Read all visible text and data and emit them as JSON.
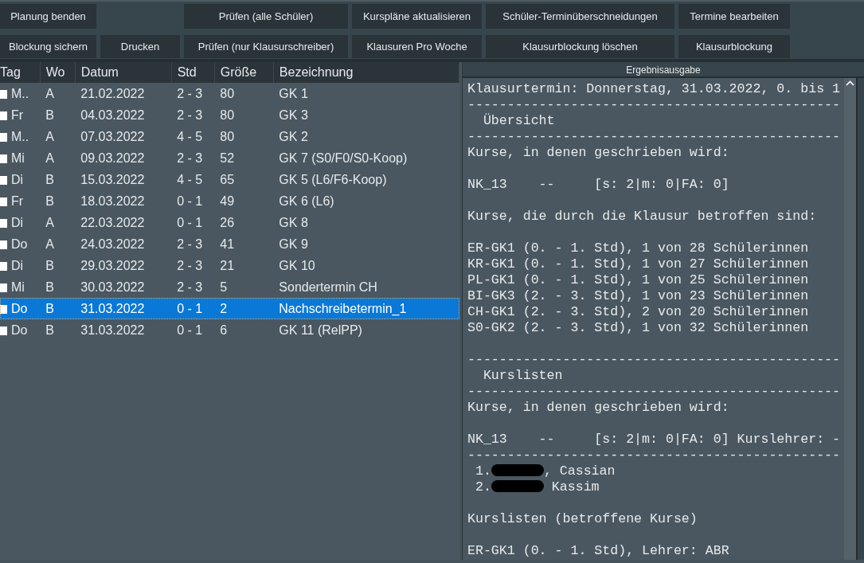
{
  "toolbar": {
    "rows": [
      [
        {
          "label": "Planung benden"
        },
        {
          "kind": "gap"
        },
        {
          "label": "Prüfen (alle Schüler)"
        },
        {
          "label": "Kurspläne aktualisieren"
        },
        {
          "label": "Schüler-Terminüberschneidungen"
        },
        {
          "label": "Termine bearbeiten"
        }
      ],
      [
        {
          "label": "Blockung sichern"
        },
        {
          "label": "Drucken"
        },
        {
          "label": "Prüfen (nur Klausurschreiber)"
        },
        {
          "label": "Klausuren Pro Woche"
        },
        {
          "label": "Klausurblockung löschen"
        },
        {
          "label": "Klausurblockung"
        }
      ]
    ]
  },
  "table": {
    "columns": [
      "Tag",
      "Wo",
      "Datum",
      "Std",
      "Größe",
      "Bezeichnung"
    ],
    "rows": [
      {
        "checked": false,
        "selected": false,
        "cells": [
          "M..",
          "A",
          "21.02.2022",
          "2 - 3",
          "80",
          "GK 1"
        ]
      },
      {
        "checked": false,
        "selected": false,
        "cells": [
          "Fr",
          "B",
          "04.03.2022",
          "2 - 3",
          "80",
          "GK 3"
        ]
      },
      {
        "checked": false,
        "selected": false,
        "cells": [
          "M..",
          "A",
          "07.03.2022",
          "4 - 5",
          "80",
          "GK 2"
        ]
      },
      {
        "checked": false,
        "selected": false,
        "cells": [
          "Mi",
          "A",
          "09.03.2022",
          "2 - 3",
          "52",
          "GK 7 (S0/F0/S0-Koop)"
        ]
      },
      {
        "checked": false,
        "selected": false,
        "cells": [
          "Di",
          "B",
          "15.03.2022",
          "4 - 5",
          "65",
          "GK 5 (L6/F6-Koop)"
        ]
      },
      {
        "checked": false,
        "selected": false,
        "cells": [
          "Fr",
          "B",
          "18.03.2022",
          "0 - 1",
          "49",
          "GK 6 (L6)"
        ]
      },
      {
        "checked": false,
        "selected": false,
        "cells": [
          "Di",
          "A",
          "22.03.2022",
          "0 - 1",
          "26",
          "GK 8"
        ]
      },
      {
        "checked": false,
        "selected": false,
        "cells": [
          "Do",
          "A",
          "24.03.2022",
          "2 - 3",
          "41",
          "GK 9"
        ]
      },
      {
        "checked": false,
        "selected": false,
        "cells": [
          "Di",
          "B",
          "29.03.2022",
          "2 - 3",
          "21",
          "GK 10"
        ]
      },
      {
        "checked": false,
        "selected": false,
        "cells": [
          "Mi",
          "B",
          "30.03.2022",
          "2 - 3",
          "5",
          "Sondertermin CH"
        ]
      },
      {
        "checked": false,
        "selected": true,
        "cells": [
          "Do",
          "B",
          "31.03.2022",
          "0 - 1",
          "2",
          "Nachschreibetermin_1"
        ]
      },
      {
        "checked": false,
        "selected": false,
        "cells": [
          "Do",
          "B",
          "31.03.2022",
          "0 - 1",
          "6",
          "GK 11 (RelPP)"
        ]
      }
    ]
  },
  "output": {
    "title": "Ergebnisausgabe",
    "lines": [
      {
        "kind": "text",
        "text": "Klausurtermin: Donnerstag, 31.03.2022, 0. bis 1"
      },
      {
        "kind": "text",
        "text": "-----------------------------------------------"
      },
      {
        "kind": "text",
        "text": "  Übersicht"
      },
      {
        "kind": "text",
        "text": "-----------------------------------------------"
      },
      {
        "kind": "text",
        "text": "Kurse, in denen geschrieben wird:"
      },
      {
        "kind": "blank"
      },
      {
        "kind": "text",
        "text": "NK_13    --     [s: 2|m: 0|FA: 0]"
      },
      {
        "kind": "blank"
      },
      {
        "kind": "text",
        "text": "Kurse, die durch die Klausur betroffen sind:"
      },
      {
        "kind": "blank"
      },
      {
        "kind": "text",
        "text": "ER-GK1 (0. - 1. Std), 1 von 28 Schülerinnen"
      },
      {
        "kind": "text",
        "text": "KR-GK1 (0. - 1. Std), 1 von 27 Schülerinnen"
      },
      {
        "kind": "text",
        "text": "PL-GK1 (0. - 1. Std), 1 von 25 Schülerinnen"
      },
      {
        "kind": "text",
        "text": "BI-GK3 (2. - 3. Std), 1 von 23 Schülerinnen"
      },
      {
        "kind": "text",
        "text": "CH-GK1 (2. - 3. Std), 2 von 20 Schülerinnen"
      },
      {
        "kind": "text",
        "text": "S0-GK2 (2. - 3. Std), 1 von 32 Schülerinnen"
      },
      {
        "kind": "blank"
      },
      {
        "kind": "text",
        "text": "-----------------------------------------------"
      },
      {
        "kind": "text",
        "text": "  Kurslisten"
      },
      {
        "kind": "text",
        "text": "-----------------------------------------------"
      },
      {
        "kind": "text",
        "text": "Kurse, in denen geschrieben wird:"
      },
      {
        "kind": "blank"
      },
      {
        "kind": "text",
        "text": "NK_13    --     [s: 2|m: 0|FA: 0] Kurslehrer: -"
      },
      {
        "kind": "text",
        "text": "-----------------------------------------------"
      },
      {
        "kind": "redacted",
        "prefix": " 1.",
        "suffix": ", Cassian"
      },
      {
        "kind": "redacted",
        "prefix": " 2.",
        "suffix": " Kassim"
      },
      {
        "kind": "blank"
      },
      {
        "kind": "text",
        "text": "Kurslisten (betroffene Kurse)"
      },
      {
        "kind": "blank"
      },
      {
        "kind": "text",
        "text": "ER-GK1 (0. - 1. Std), Lehrer: ABR"
      }
    ]
  }
}
